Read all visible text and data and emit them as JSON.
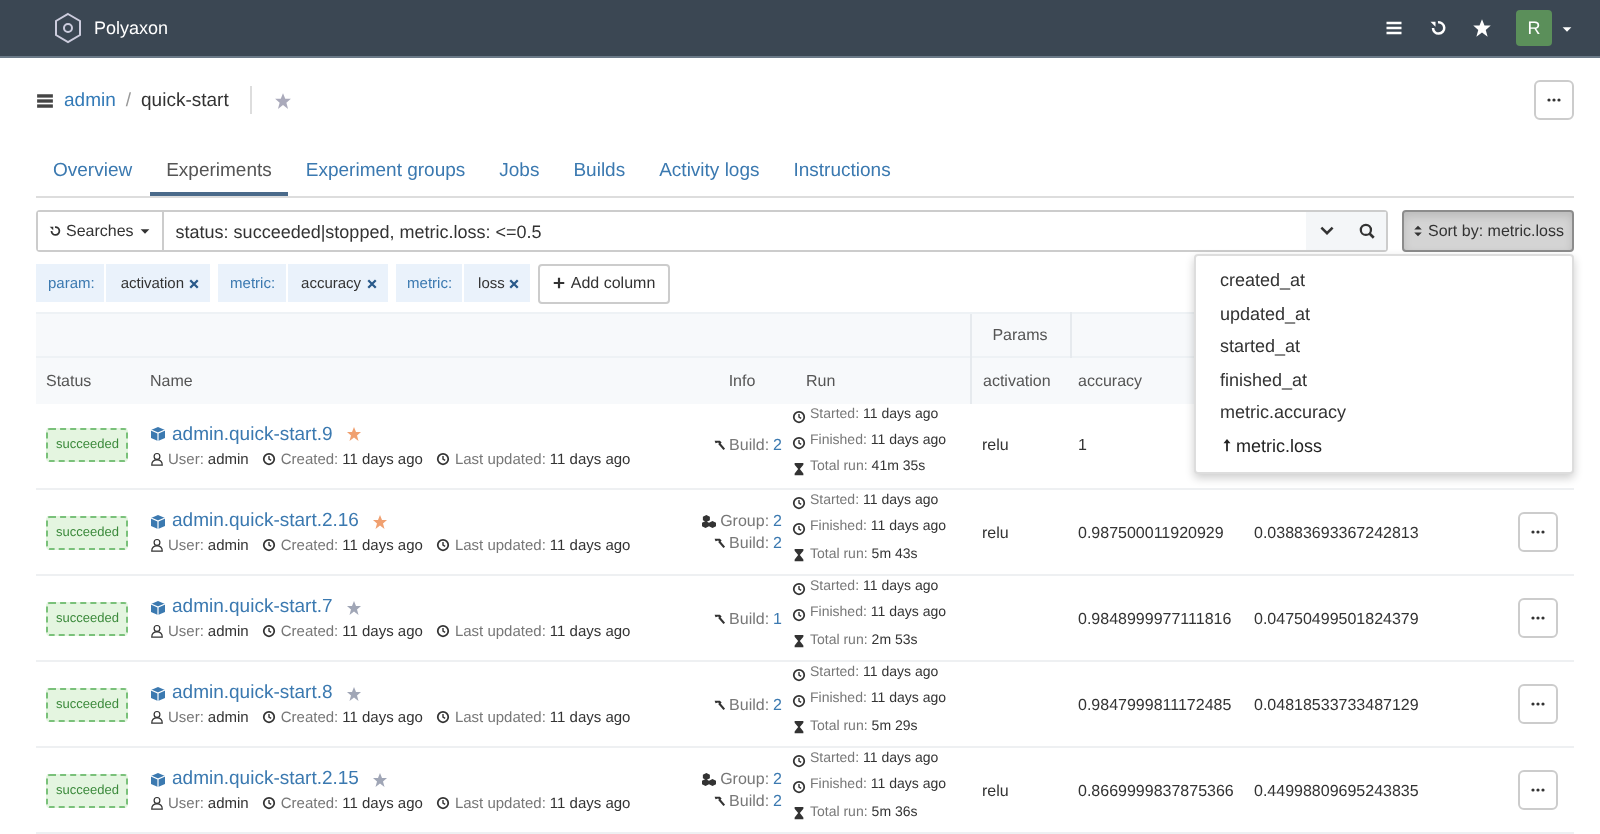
{
  "navbar": {
    "brand": "Polyaxon",
    "avatar": "R"
  },
  "breadcrumb": {
    "owner": "admin",
    "separator": "/",
    "project": "quick-start",
    "starred": false
  },
  "tabs": [
    {
      "label": "Overview",
      "selected": false
    },
    {
      "label": "Experiments",
      "selected": true
    },
    {
      "label": "Experiment groups",
      "selected": false
    },
    {
      "label": "Jobs",
      "selected": false
    },
    {
      "label": "Builds",
      "selected": false
    },
    {
      "label": "Activity logs",
      "selected": false
    },
    {
      "label": "Instructions",
      "selected": false
    }
  ],
  "search": {
    "searches_label": "Searches",
    "query": "status: succeeded|stopped, metric.loss: <=0.5"
  },
  "sort": {
    "label": "Sort by: metric.loss",
    "expanded": true,
    "options": [
      {
        "label": "created_at",
        "selected": false
      },
      {
        "label": "updated_at",
        "selected": false
      },
      {
        "label": "started_at",
        "selected": false
      },
      {
        "label": "finished_at",
        "selected": false
      },
      {
        "label": "metric.accuracy",
        "selected": false
      },
      {
        "label": "metric.loss",
        "selected": true
      }
    ]
  },
  "column_chips": [
    {
      "type": "param:",
      "value": "activation"
    },
    {
      "type": "metric:",
      "value": "accuracy"
    },
    {
      "type": "metric:",
      "value": "loss"
    }
  ],
  "add_column": "Add column",
  "table": {
    "group_header": "Params",
    "columns": [
      "Status",
      "Name",
      "Info",
      "Run",
      "activation",
      "accuracy"
    ],
    "rows": [
      {
        "status": "succeeded",
        "name": "admin.quick-start.9",
        "starred": true,
        "user_label": "User:",
        "user": "admin",
        "created_label": "Created:",
        "created": "11 days ago",
        "updated_label": "Last updated:",
        "updated": "11 days ago",
        "info": [
          {
            "kind": "build",
            "label": "Build:",
            "value": "2"
          }
        ],
        "started_label": "Started:",
        "started": "11 days ago",
        "finished_label": "Finished:",
        "finished": "11 days ago",
        "total_label": "Total run:",
        "total": "41m 35s",
        "activation": "relu",
        "accuracy": "1"
      },
      {
        "status": "succeeded",
        "name": "admin.quick-start.2.16",
        "starred": true,
        "user_label": "User:",
        "user": "admin",
        "created_label": "Created:",
        "created": "11 days ago",
        "updated_label": "Last updated:",
        "updated": "11 days ago",
        "info": [
          {
            "kind": "group",
            "label": "Group:",
            "value": "2"
          },
          {
            "kind": "build",
            "label": "Build:",
            "value": "2"
          }
        ],
        "started_label": "Started:",
        "started": "11 days ago",
        "finished_label": "Finished:",
        "finished": "11 days ago",
        "total_label": "Total run:",
        "total": "5m 43s",
        "activation": "relu",
        "accuracy": "0.987500011920929",
        "loss": "0.03883693367242813"
      },
      {
        "status": "succeeded",
        "name": "admin.quick-start.7",
        "starred": false,
        "user_label": "User:",
        "user": "admin",
        "created_label": "Created:",
        "created": "11 days ago",
        "updated_label": "Last updated:",
        "updated": "11 days ago",
        "info": [
          {
            "kind": "build",
            "label": "Build:",
            "value": "1"
          }
        ],
        "started_label": "Started:",
        "started": "11 days ago",
        "finished_label": "Finished:",
        "finished": "11 days ago",
        "total_label": "Total run:",
        "total": "2m 53s",
        "accuracy": "0.9848999977111816",
        "loss": "0.04750499501824379"
      },
      {
        "status": "succeeded",
        "name": "admin.quick-start.8",
        "starred": false,
        "user_label": "User:",
        "user": "admin",
        "created_label": "Created:",
        "created": "11 days ago",
        "updated_label": "Last updated:",
        "updated": "11 days ago",
        "info": [
          {
            "kind": "build",
            "label": "Build:",
            "value": "2"
          }
        ],
        "started_label": "Started:",
        "started": "11 days ago",
        "finished_label": "Finished:",
        "finished": "11 days ago",
        "total_label": "Total run:",
        "total": "5m 29s",
        "accuracy": "0.9847999811172485",
        "loss": "0.04818533733487129"
      },
      {
        "status": "succeeded",
        "name": "admin.quick-start.2.15",
        "starred": false,
        "user_label": "User:",
        "user": "admin",
        "created_label": "Created:",
        "created": "11 days ago",
        "updated_label": "Last updated:",
        "updated": "11 days ago",
        "info": [
          {
            "kind": "group",
            "label": "Group:",
            "value": "2"
          },
          {
            "kind": "build",
            "label": "Build:",
            "value": "2"
          }
        ],
        "started_label": "Started:",
        "started": "11 days ago",
        "finished_label": "Finished:",
        "finished": "11 days ago",
        "total_label": "Total run:",
        "total": "5m 36s",
        "activation": "relu",
        "accuracy": "0.8669999837875366",
        "loss": "0.44998809695243835"
      }
    ]
  }
}
